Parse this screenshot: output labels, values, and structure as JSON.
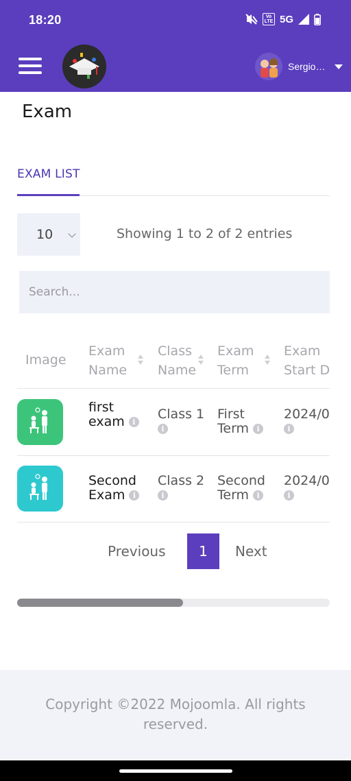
{
  "status_bar": {
    "time": "18:20",
    "network": "5G",
    "volte": "Vo LTE"
  },
  "app_bar": {
    "user_name": "Sergio Thomp"
  },
  "page": {
    "title": "Exam"
  },
  "tabs": [
    {
      "label": "EXAM LIST"
    }
  ],
  "table_controls": {
    "page_length": "10",
    "entries_info": "Showing 1 to 2 of 2 entries",
    "search_placeholder": "Search..."
  },
  "table": {
    "columns": [
      "Image",
      "Exam Name",
      "Class Name",
      "Exam Term",
      "Exam Start D"
    ],
    "rows": [
      {
        "exam_name": "first exam",
        "class_name": "Class 1",
        "exam_term": "First Term",
        "start_date": "2024/0",
        "thumb_color": "#3cc57a"
      },
      {
        "exam_name": "Second Exam",
        "class_name": "Class 2",
        "exam_term": "Second Term",
        "start_date": "2024/0",
        "thumb_color": "#2ec9cf"
      }
    ],
    "info_glyph": "i"
  },
  "pagination": {
    "previous": "Previous",
    "current": "1",
    "next": "Next"
  },
  "scroll": {
    "visible_fraction": 0.53
  },
  "footer": {
    "copyright": "Copyright ©2022 Mojoomla. All rights reserved."
  },
  "colors": {
    "primary": "#5b3ebd",
    "input_bg": "#eef1f7",
    "footer_bg": "#f1f3f8"
  }
}
